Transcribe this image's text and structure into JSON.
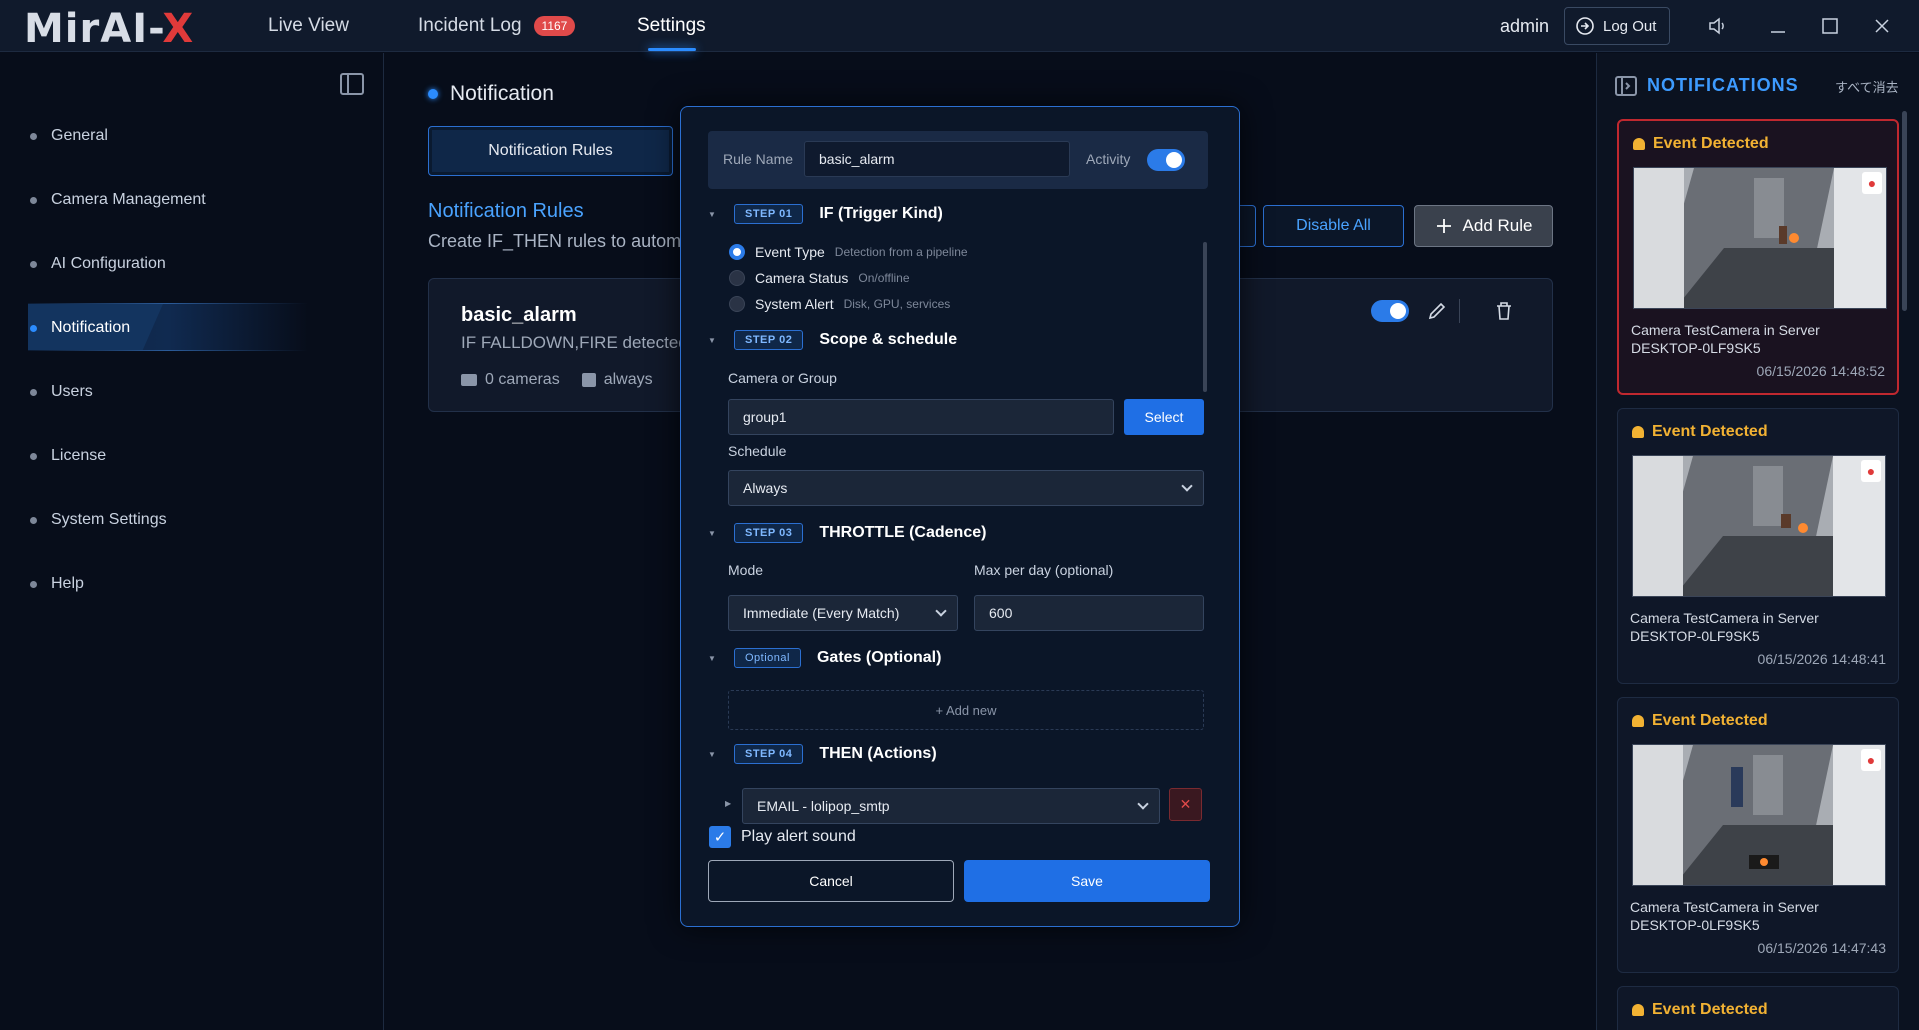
{
  "app": {
    "logo_main": "MirAI-",
    "logo_x": "X"
  },
  "topnav": {
    "live_view": "Live View",
    "incident_log": "Incident Log",
    "incident_count": "1167",
    "settings": "Settings",
    "user": "admin",
    "logout": "Log Out"
  },
  "sidebar": {
    "items": [
      {
        "label": "General"
      },
      {
        "label": "Camera Management"
      },
      {
        "label": "AI Configuration"
      },
      {
        "label": "Notification"
      },
      {
        "label": "Users"
      },
      {
        "label": "License"
      },
      {
        "label": "System Settings"
      },
      {
        "label": "Help"
      }
    ],
    "active": "Notification"
  },
  "main": {
    "title": "Notification",
    "tab_rules": "Notification Rules",
    "rules_heading": "Notification Rules",
    "rules_subtitle": "Create IF_THEN rules to automa",
    "disable_all": "Disable All",
    "add_rule": "Add Rule",
    "rule": {
      "name": "basic_alarm",
      "desc": "IF FALLDOWN,FIRE detected",
      "cameras": "0 cameras",
      "schedule": "always",
      "enabled": true
    }
  },
  "modal": {
    "rule_name_label": "Rule Name",
    "rule_name_value": "basic_alarm",
    "activity_label": "Activity",
    "step1": {
      "badge": "STEP 01",
      "title": "IF (Trigger Kind)"
    },
    "triggers": [
      {
        "label": "Event Type",
        "hint": "Detection from a pipeline",
        "selected": true
      },
      {
        "label": "Camera Status",
        "hint": "On/offline",
        "selected": false
      },
      {
        "label": "System Alert",
        "hint": "Disk, GPU, services",
        "selected": false
      }
    ],
    "step2": {
      "badge": "STEP 02",
      "title": "Scope & schedule"
    },
    "camera_group_label": "Camera or Group",
    "camera_group_value": "group1",
    "select_label": "Select",
    "schedule_label": "Schedule",
    "schedule_value": "Always",
    "step3": {
      "badge": "STEP 03",
      "title": "THROTTLE (Cadence)"
    },
    "mode_label": "Mode",
    "mode_value": "Immediate (Every Match)",
    "max_label": "Max per day (optional)",
    "max_value": "600",
    "optional": {
      "badge": "Optional",
      "title": "Gates (Optional)"
    },
    "add_new": "+ Add new",
    "step4": {
      "badge": "STEP 04",
      "title": "THEN (Actions)"
    },
    "action_value": "EMAIL - lolipop_smtp",
    "play_sound_label": "Play alert sound",
    "play_sound_checked": true,
    "cancel": "Cancel",
    "save": "Save"
  },
  "notifications": {
    "title": "NOTIFICATIONS",
    "clear_all": "すべて消去",
    "items": [
      {
        "title": "Event Detected",
        "text": "Camera TestCamera in Server DESKTOP-0LF9SK5",
        "time": "06/15/2026 14:48:52"
      },
      {
        "title": "Event Detected",
        "text": "Camera TestCamera in Server DESKTOP-0LF9SK5",
        "time": "06/15/2026 14:48:41"
      },
      {
        "title": "Event Detected",
        "text": "Camera TestCamera in Server DESKTOP-0LF9SK5",
        "time": "06/15/2026 14:47:43"
      },
      {
        "title": "Event Detected"
      }
    ]
  },
  "colors": {
    "accent": "#2b8cff",
    "alert": "#e04a4a",
    "warning": "#f2b233"
  }
}
